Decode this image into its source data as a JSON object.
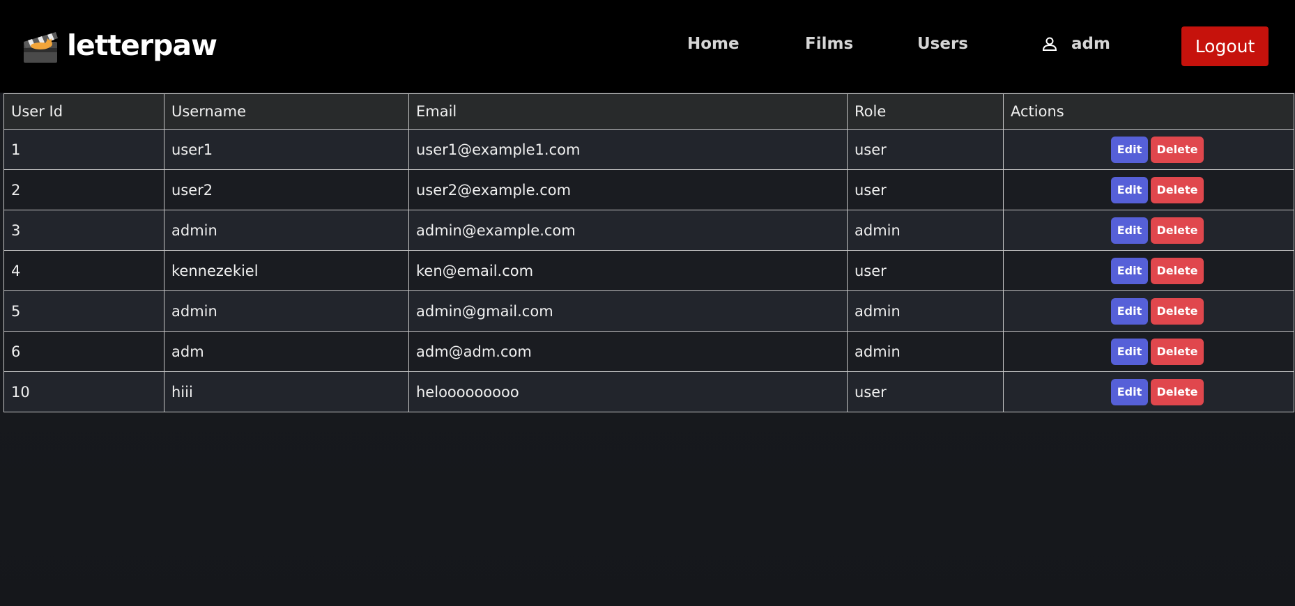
{
  "brand": {
    "name": "letterpaw",
    "logo_icon": "clapperboard-icon"
  },
  "nav": {
    "links": [
      "Home",
      "Films",
      "Users"
    ],
    "user": {
      "icon": "person-icon",
      "name": "adm"
    },
    "logout_label": "Logout"
  },
  "colors": {
    "navbar_bg": "#000000",
    "logout_bg": "#c6120c",
    "edit_bg": "#5660d8",
    "delete_bg": "#e0474d",
    "page_bg": "#1b1d22"
  },
  "table": {
    "columns": [
      "User Id",
      "Username",
      "Email",
      "Role",
      "Actions"
    ],
    "edit_label": "Edit",
    "delete_label": "Delete",
    "rows": [
      {
        "id": "1",
        "username": "user1",
        "email": "user1@example1.com",
        "role": "user"
      },
      {
        "id": "2",
        "username": "user2",
        "email": "user2@example.com",
        "role": "user"
      },
      {
        "id": "3",
        "username": "admin",
        "email": "admin@example.com",
        "role": "admin"
      },
      {
        "id": "4",
        "username": "kennezekiel",
        "email": "ken@email.com",
        "role": "user"
      },
      {
        "id": "5",
        "username": "admin",
        "email": "admin@gmail.com",
        "role": "admin"
      },
      {
        "id": "6",
        "username": "adm",
        "email": "adm@adm.com",
        "role": "admin"
      },
      {
        "id": "10",
        "username": "hiii",
        "email": "helooooooooo",
        "role": "user"
      }
    ]
  }
}
